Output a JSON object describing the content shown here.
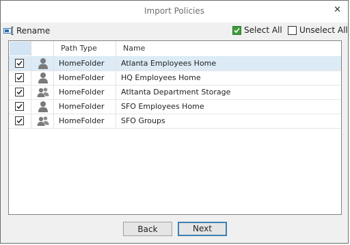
{
  "window": {
    "title": "Import Policies"
  },
  "toolbar": {
    "rename_label": "Rename",
    "select_all_label": "Select All",
    "select_all_checked": true,
    "unselect_all_label": "Unselect All",
    "unselect_all_checked": false
  },
  "grid": {
    "columns": [
      "Path Type",
      "Name"
    ],
    "rows": [
      {
        "checked": true,
        "icon": "user-icon",
        "path_type": "HomeFolder",
        "name": "Atlanta Employees Home",
        "selected": true
      },
      {
        "checked": true,
        "icon": "user-icon",
        "path_type": "HomeFolder",
        "name": "HQ Employees Home",
        "selected": false
      },
      {
        "checked": true,
        "icon": "group-icon",
        "path_type": "HomeFolder",
        "name": "Atltanta Department Storage",
        "selected": false
      },
      {
        "checked": true,
        "icon": "user-icon",
        "path_type": "HomeFolder",
        "name": "SFO Employees Home",
        "selected": false
      },
      {
        "checked": true,
        "icon": "group-icon",
        "path_type": "HomeFolder",
        "name": "SFO Groups",
        "selected": false
      }
    ]
  },
  "footer": {
    "back_label": "Back",
    "next_label": "Next"
  },
  "colors": {
    "accent": "#3c7fb1",
    "checked_green": "#3c9c3c",
    "row_selected": "#dcebf6"
  }
}
